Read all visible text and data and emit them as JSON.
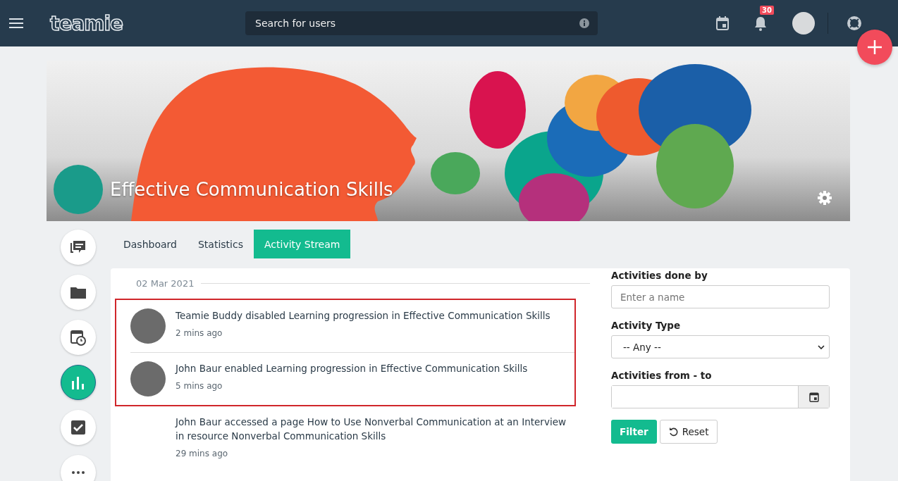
{
  "header": {
    "logo": "teamie",
    "search": {
      "placeholder": "Search for users"
    },
    "notifications": {
      "count": "30"
    }
  },
  "course": {
    "title": "Effective Communication Skills"
  },
  "side_nav": [
    {
      "kind": "posts",
      "selected": false
    },
    {
      "kind": "folder",
      "selected": false
    },
    {
      "kind": "calendar",
      "selected": false
    },
    {
      "kind": "chart",
      "selected": true
    },
    {
      "kind": "tasks",
      "selected": false
    },
    {
      "kind": "more",
      "selected": false
    }
  ],
  "tabs": [
    {
      "label": "Dashboard",
      "selected": false
    },
    {
      "label": "Statistics",
      "selected": false
    },
    {
      "label": "Activity Stream",
      "selected": true
    }
  ],
  "feed": {
    "date": "02 Mar 2021",
    "activities": [
      {
        "text": "Teamie Buddy disabled Learning progression in Effective Communication Skills",
        "time": "2 mins ago",
        "has_avatar": true,
        "highlighted": true
      },
      {
        "text": "John Baur enabled Learning progression in Effective Communication Skills",
        "time": "5 mins ago",
        "has_avatar": true,
        "highlighted": true
      },
      {
        "text": "John Baur accessed a page How to Use Nonverbal Communication at an Interview in resource Nonverbal Communication Skills",
        "time": "29 mins ago",
        "has_avatar": false,
        "highlighted": false
      }
    ]
  },
  "filters": {
    "done_by": {
      "label": "Activities done by",
      "placeholder": "Enter a name"
    },
    "type": {
      "label": "Activity Type",
      "value": "-- Any --"
    },
    "range": {
      "label": "Activities from - to"
    },
    "buttons": [
      {
        "kind": "primary",
        "label": "Filter"
      },
      {
        "kind": "reset",
        "label": "Reset"
      }
    ]
  }
}
